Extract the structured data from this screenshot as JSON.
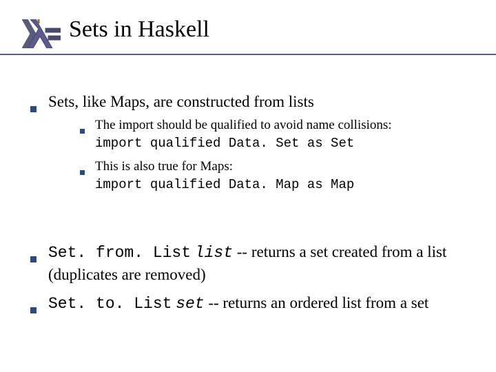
{
  "header": {
    "title": "Sets in Haskell"
  },
  "bullets": {
    "p1": {
      "text": "Sets, like Maps, are constructed from lists",
      "sub": [
        {
          "text": "The import should be qualified to avoid name collisions:",
          "code": "import qualified Data. Set as Set"
        },
        {
          "text": "This is also true for Maps:",
          "code": "import qualified Data. Map as Map"
        }
      ]
    },
    "p2": {
      "code": "Set. from. List",
      "arg": "list",
      "rest": " -- returns a set created from a list (duplicates are removed)"
    },
    "p3": {
      "code": "Set. to. List",
      "arg": "set",
      "rest": " -- returns an ordered list from a set"
    }
  }
}
